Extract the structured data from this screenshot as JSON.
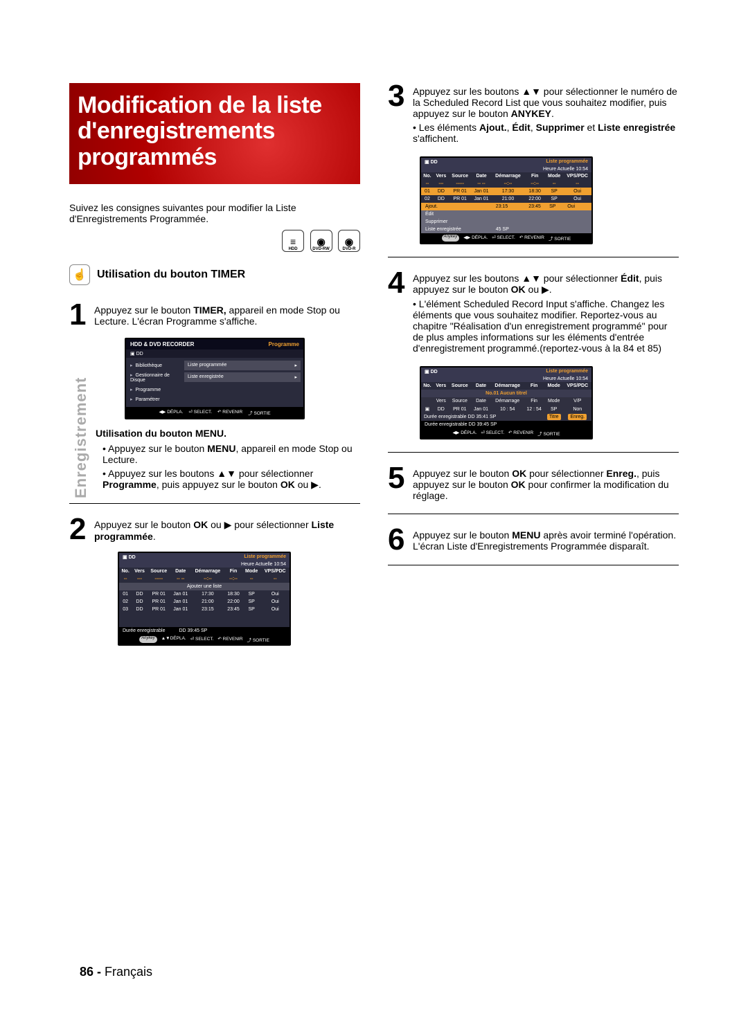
{
  "title_line1": "Modification de la liste",
  "title_line2": "d'enregistrements programmés",
  "intro": "Suivez les consignes suivantes pour modifier la Liste d'Enregistrements Programmée.",
  "icons": {
    "hdd": "HDD",
    "dvdrw": "DVD-RW",
    "dvdr": "DVD-R"
  },
  "h2": "Utilisation du bouton TIMER",
  "step1_a": "Appuyez sur le bouton ",
  "step1_b": "TIMER,",
  "step1_c": " appareil en mode Stop ou Lecture. L'écran Programme s'affiche.",
  "menu_sub": "Utilisation du bouton MENU.",
  "menu_b1_a": "Appuyez sur le bouton ",
  "menu_b1_b": "MENU",
  "menu_b1_c": ", appareil en mode Stop ou Lecture.",
  "menu_b2_a": "Appuyez sur les boutons ▲▼ pour sélectionner ",
  "menu_b2_b": "Programme",
  "menu_b2_c": ", puis appuyez sur le bouton ",
  "menu_b2_d": "OK",
  "menu_b2_e": " ou ▶.",
  "step2_a": "Appuyez sur le bouton ",
  "step2_b": "OK",
  "step2_c": " ou ▶ pour sélectionner ",
  "step2_d": "Liste programmée",
  "step2_e": ".",
  "step3_a": "Appuyez sur les boutons ▲▼ pour sélectionner le numéro de la Scheduled Record List que vous souhaitez modifier, puis appuyez sur le bouton ",
  "step3_b": "ANYKEY",
  "step3_c": ".",
  "step3_bul_a": "Les éléments ",
  "step3_bul_b": "Ajout.",
  "step3_bul_c": ", ",
  "step3_bul_d": "Édit",
  "step3_bul_e": ", ",
  "step3_bul_f": "Supprimer",
  "step3_bul_g": " et ",
  "step3_bul_h": "Liste enregistrée",
  "step3_bul_i": " s'affichent.",
  "step4_a": "Appuyez sur les boutons ▲▼ pour sélectionner ",
  "step4_b": "Édit",
  "step4_c": ", puis appuyez sur le bouton ",
  "step4_d": "OK",
  "step4_e": " ou ▶.",
  "step4_bul": "L'élément Scheduled Record Input s'affiche. Changez les éléments que vous souhaitez modifier. Reportez-vous au chapitre \"Réalisation d'un enregistrement programmé\" pour de plus amples informations sur les éléments d'entrée d'enregistrement programmé.(reportez-vous à la 84 et 85)",
  "step5_a": "Appuyez sur le bouton ",
  "step5_b": "OK",
  "step5_c": " pour sélectionner ",
  "step5_d": "Enreg.",
  "step5_e": ", puis appuyez sur le bouton ",
  "step5_f": "OK",
  "step5_g": " pour confirmer la modification du réglage.",
  "step6_a": "Appuyez sur le bouton ",
  "step6_b": "MENU",
  "step6_c": " après avoir terminé l'opération.",
  "step6_d": "L'écran Liste d'Enregistrements Programmée disparaît.",
  "side": "Enregistrement",
  "footer_num": "86 - ",
  "footer_lang": "Français",
  "osd1": {
    "title_l": "HDD & DVD RECORDER",
    "title_r": "Programme",
    "dd": "DD",
    "items": [
      "Bibliothèque",
      "Gestionnaire de Disque",
      "Programme",
      "Paramétrer"
    ],
    "menu": [
      "Liste programmée",
      "Liste enregistrée"
    ],
    "foot": [
      "◀▶ DÉPLA.",
      "⏎ SELECT.",
      "↶ REVENIR",
      "⤴ SORTIE"
    ]
  },
  "osd2": {
    "dd": "DD",
    "title_r": "Liste programmée",
    "time": "Heure Actuelle 10:54",
    "cols": [
      "No.",
      "Vers",
      "Source",
      "Date",
      "Démarrage",
      "Fin",
      "Mode",
      "VPS/PDC"
    ],
    "hdr": [
      "--",
      "---",
      "-----",
      "-- --",
      "--:--",
      "--:--",
      "--",
      "--"
    ],
    "add": "Ajouter une liste",
    "rows": [
      [
        "01",
        "DD",
        "PR 01",
        "Jan 01",
        "17:30",
        "18:30",
        "SP",
        "Oui"
      ],
      [
        "02",
        "DD",
        "PR 01",
        "Jan 01",
        "21:00",
        "22:00",
        "SP",
        "Oui"
      ],
      [
        "03",
        "DD",
        "PR 01",
        "Jan 01",
        "23:15",
        "23:45",
        "SP",
        "Oui"
      ]
    ],
    "dur_l": "Durée enregistrable",
    "dur_r": "DD  39:45 SP",
    "anykey": "Anykey",
    "foot": [
      "▲▼DÉPLA.",
      "⏎ SELECT.",
      "↶ REVENIR",
      "⤴ SORTIE"
    ]
  },
  "osd3": {
    "dd": "DD",
    "title_r": "Liste programmée",
    "time": "Heure Actuelle 10:54",
    "cols": [
      "No.",
      "Vers",
      "Source",
      "Date",
      "Démarrage",
      "Fin",
      "Mode",
      "VPS/PDC"
    ],
    "hdr": [
      "--",
      "---",
      "-----",
      "-- --",
      "--:--",
      "--:--",
      "--",
      "--"
    ],
    "rows": [
      [
        "01",
        "DD",
        "PR 01",
        "Jan 01",
        "17:30",
        "18:30",
        "SP",
        "Oui"
      ],
      [
        "02",
        "DD",
        "PR 01",
        "Jan 01",
        "21:00",
        "22:00",
        "SP",
        "Oui"
      ],
      [
        "",
        "",
        "",
        "",
        "23:15",
        "23:45",
        "SP",
        "Oui"
      ]
    ],
    "menu": [
      "Ajout.",
      "Édit",
      "Supprimer",
      "Liste enregistrée"
    ],
    "sp": "45 SP",
    "anykey": "Anykey",
    "foot": [
      "◀▶ DÉPLA.",
      "⏎ SELECT.",
      "↶ REVENIR",
      "⤴ SORTIE"
    ]
  },
  "osd4": {
    "dd": "DD",
    "title_r": "Liste programmée",
    "time": "Heure Actuelle 10:54",
    "cols": [
      "No.",
      "Vers",
      "Source",
      "Date",
      "Démarrage",
      "Fin",
      "Mode",
      "VPS/PDC"
    ],
    "boxtitle": "No.01 Aucun titrel",
    "boxcols": [
      "Vers",
      "Source",
      "Date",
      "Démarrage",
      "Fin",
      "Mode",
      "V/P"
    ],
    "boxrow": [
      "DD",
      "PR 01",
      "Jan 01",
      "10 : 54",
      "12 : 54",
      "SP",
      "Non"
    ],
    "durbox_l": "Durée enregistrable   DD   35:41 SP",
    "btn_t": "Titre",
    "btn_e": "Enreg.",
    "dur": "Durée enregistrable   DD              39:45 SP",
    "foot": [
      "◀▶ DÉPLA.",
      "⏎ SELECT.",
      "↶ REVENIR",
      "⤴ SORTIE"
    ]
  }
}
